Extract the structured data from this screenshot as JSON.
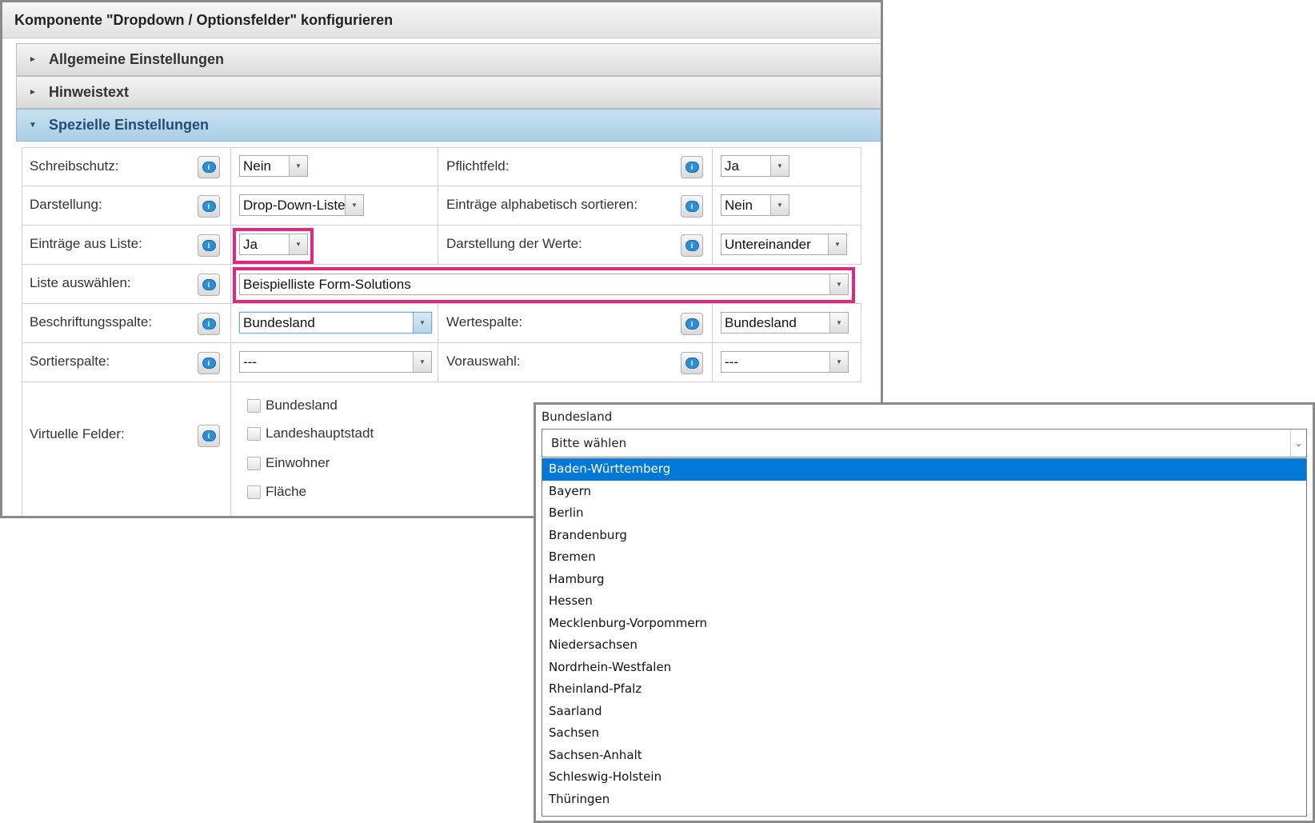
{
  "dialog": {
    "title": "Komponente \"Dropdown / Optionsfelder\" konfigurieren",
    "sections": [
      {
        "label": "Allgemeine Einstellungen",
        "expanded": false
      },
      {
        "label": "Hinweistext",
        "expanded": false
      },
      {
        "label": "Spezielle Einstellungen",
        "expanded": true
      }
    ],
    "fields": {
      "schreibschutz": {
        "label": "Schreibschutz:",
        "value": "Nein"
      },
      "pflichtfeld": {
        "label": "Pflichtfeld:",
        "value": "Ja"
      },
      "darstellung": {
        "label": "Darstellung:",
        "value": "Drop-Down-Liste"
      },
      "sortieren": {
        "label": "Einträge alphabetisch sortieren:",
        "value": "Nein"
      },
      "eintraege_aus_liste": {
        "label": "Einträge aus Liste:",
        "value": "Ja"
      },
      "darstellung_werte": {
        "label": "Darstellung der Werte:",
        "value": "Untereinander"
      },
      "liste_auswaehlen": {
        "label": "Liste auswählen:",
        "value": "Beispielliste Form-Solutions"
      },
      "beschriftungsspalte": {
        "label": "Beschriftungsspalte:",
        "value": "Bundesland"
      },
      "wertespalte": {
        "label": "Wertespalte:",
        "value": "Bundesland"
      },
      "sortierspalte": {
        "label": "Sortierspalte:",
        "value": "---"
      },
      "vorauswahl": {
        "label": "Vorauswahl:",
        "value": "---"
      },
      "virtuelle_felder": {
        "label": "Virtuelle Felder:",
        "options": [
          "Bundesland",
          "Landeshauptstadt",
          "Einwohner",
          "Fläche"
        ]
      }
    },
    "info_icon": "info-speech-bubble-icon",
    "highlight_color": "#e0287f"
  },
  "preview": {
    "label": "Bundesland",
    "placeholder": "Bitte wählen",
    "selected_index": 0,
    "options": [
      "Baden-Württemberg",
      "Bayern",
      "Berlin",
      "Brandenburg",
      "Bremen",
      "Hamburg",
      "Hessen",
      "Mecklenburg-Vorpommern",
      "Niedersachsen",
      "Nordrhein-Westfalen",
      "Rheinland-Pfalz",
      "Saarland",
      "Sachsen",
      "Sachsen-Anhalt",
      "Schleswig-Holstein",
      "Thüringen"
    ],
    "selected_color": "#0078d7"
  }
}
